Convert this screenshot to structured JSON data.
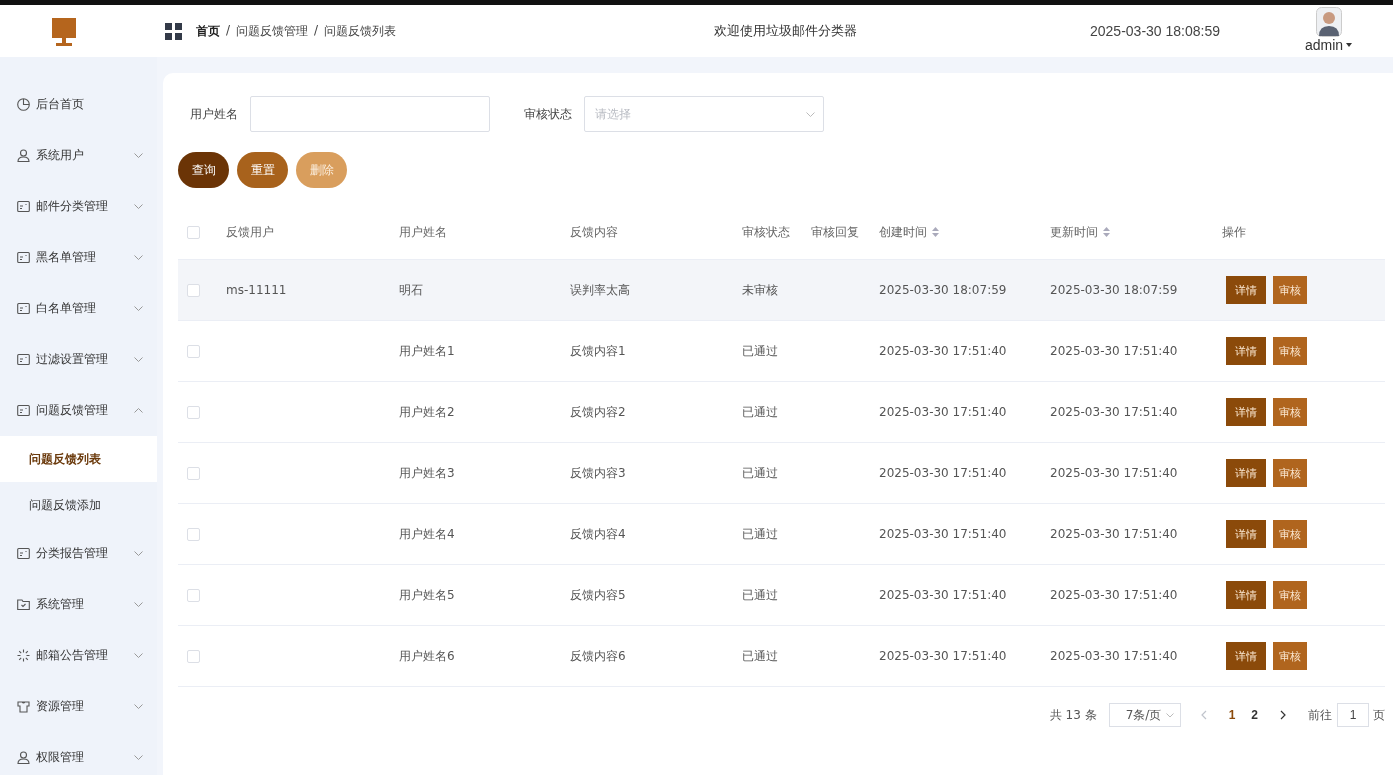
{
  "header": {
    "breadcrumb": [
      "首页",
      "问题反馈管理",
      "问题反馈列表"
    ],
    "breadcrumb_separator": "/",
    "title": "欢迎使用垃圾邮件分类器",
    "datetime": "2025-03-30 18:08:59",
    "user": "admin"
  },
  "sidebar": {
    "items": [
      {
        "label": "后台首页",
        "kind": "pie"
      },
      {
        "label": "系统用户",
        "kind": "user",
        "expanded": false
      },
      {
        "label": "邮件分类管理",
        "kind": "card",
        "expanded": false
      },
      {
        "label": "黑名单管理",
        "kind": "card",
        "expanded": false
      },
      {
        "label": "白名单管理",
        "kind": "card",
        "expanded": false
      },
      {
        "label": "过滤设置管理",
        "kind": "card",
        "expanded": false
      },
      {
        "label": "问题反馈管理",
        "kind": "card",
        "expanded": true,
        "children": [
          {
            "label": "问题反馈列表",
            "selected": true
          },
          {
            "label": "问题反馈添加",
            "selected": false
          }
        ]
      },
      {
        "label": "分类报告管理",
        "kind": "card",
        "expanded": false
      },
      {
        "label": "系统管理",
        "kind": "folder",
        "expanded": false
      },
      {
        "label": "邮箱公告管理",
        "kind": "spark",
        "expanded": false
      },
      {
        "label": "资源管理",
        "kind": "shirt",
        "expanded": false
      },
      {
        "label": "权限管理",
        "kind": "user",
        "expanded": false
      }
    ]
  },
  "filters": [
    {
      "label": "用户姓名",
      "kind": "input"
    },
    {
      "label": "审核状态",
      "kind": "select",
      "placeholder": "请选择"
    }
  ],
  "buttons": [
    {
      "label": "查询",
      "kind": "query"
    },
    {
      "label": "重置",
      "kind": "reset"
    },
    {
      "label": "删除",
      "kind": "delete"
    }
  ],
  "table": {
    "all_checked": false,
    "columns": [
      {
        "label": "反馈用户",
        "sortable": false
      },
      {
        "label": "用户姓名",
        "sortable": false
      },
      {
        "label": "反馈内容",
        "sortable": false
      },
      {
        "label": "审核状态",
        "sortable": false
      },
      {
        "label": "审核回复",
        "sortable": false
      },
      {
        "label": "创建时间",
        "sortable": true
      },
      {
        "label": "更新时间",
        "sortable": true
      },
      {
        "label": "操作",
        "sortable": false
      }
    ],
    "rows": [
      {
        "cells": [
          "ms-11111",
          "明石",
          "误判率太高",
          "未审核",
          "",
          "2025-03-30 18:07:59",
          "2025-03-30 18:07:59"
        ],
        "hovered": true,
        "checked": false,
        "actions": [
          "详情",
          "审核"
        ]
      },
      {
        "cells": [
          "",
          "用户姓名1",
          "反馈内容1",
          "已通过",
          "",
          "2025-03-30 17:51:40",
          "2025-03-30 17:51:40"
        ],
        "hovered": false,
        "checked": false,
        "actions": [
          "详情",
          "审核"
        ]
      },
      {
        "cells": [
          "",
          "用户姓名2",
          "反馈内容2",
          "已通过",
          "",
          "2025-03-30 17:51:40",
          "2025-03-30 17:51:40"
        ],
        "hovered": false,
        "checked": false,
        "actions": [
          "详情",
          "审核"
        ]
      },
      {
        "cells": [
          "",
          "用户姓名3",
          "反馈内容3",
          "已通过",
          "",
          "2025-03-30 17:51:40",
          "2025-03-30 17:51:40"
        ],
        "hovered": false,
        "checked": false,
        "actions": [
          "详情",
          "审核"
        ]
      },
      {
        "cells": [
          "",
          "用户姓名4",
          "反馈内容4",
          "已通过",
          "",
          "2025-03-30 17:51:40",
          "2025-03-30 17:51:40"
        ],
        "hovered": false,
        "checked": false,
        "actions": [
          "详情",
          "审核"
        ]
      },
      {
        "cells": [
          "",
          "用户姓名5",
          "反馈内容5",
          "已通过",
          "",
          "2025-03-30 17:51:40",
          "2025-03-30 17:51:40"
        ],
        "hovered": false,
        "checked": false,
        "actions": [
          "详情",
          "审核"
        ]
      },
      {
        "cells": [
          "",
          "用户姓名6",
          "反馈内容6",
          "已通过",
          "",
          "2025-03-30 17:51:40",
          "2025-03-30 17:51:40"
        ],
        "hovered": false,
        "checked": false,
        "actions": [
          "详情",
          "审核"
        ]
      }
    ]
  },
  "pagination": {
    "total": "共 13 条",
    "page_size": "7条/页",
    "pages": [
      {
        "label": "1",
        "selected": true
      },
      {
        "label": "2",
        "selected": false
      }
    ],
    "goto_label": "前往",
    "goto_value": "1",
    "goto_suffix": "页"
  }
}
